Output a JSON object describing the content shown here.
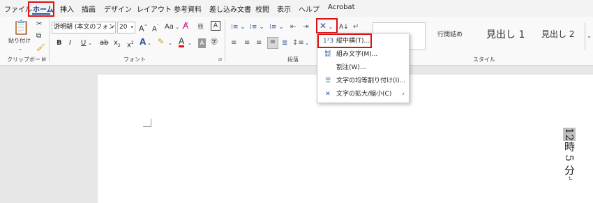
{
  "tabs": [
    "ファイル",
    "ホーム",
    "挿入",
    "描画",
    "デザイン",
    "レイアウト",
    "参考資料",
    "差し込み文書",
    "校閲",
    "表示",
    "ヘルプ",
    "Acrobat"
  ],
  "clipboard": {
    "paste_label": "貼り付け",
    "group_label": "クリップボード"
  },
  "font": {
    "name": "游明朝 (本文のフォント",
    "size": "20",
    "grow": "A",
    "shrink": "A",
    "case": "Aa",
    "bold": "B",
    "italic": "I",
    "underline": "U",
    "strike": "ab",
    "subscript": "x",
    "superscript": "x",
    "group_label": "フォント"
  },
  "paragraph": {
    "group_label": "段落"
  },
  "styles": {
    "items": [
      "行間詰め",
      "見出し 1",
      "見出し 2"
    ],
    "group_label": "スタイル"
  },
  "menu": {
    "items": [
      {
        "label": "縦中横(T)...",
        "icon": "tate-chu-yoko-icon"
      },
      {
        "label": "組み文字(M)...",
        "icon": "kumimoji-icon"
      },
      {
        "label": "割注(W)...",
        "icon": "warichu-icon"
      },
      {
        "label": "文字の均等割り付け(I)...",
        "icon": "distribute-icon"
      },
      {
        "label": "文字の拡大/縮小(C)",
        "icon": "char-scale-icon"
      }
    ]
  },
  "document": {
    "text_number": "12",
    "text_rest": "時 5 分",
    "para_mark": "↵"
  },
  "colors": {
    "accent": "#2b579a",
    "highlight": "#e01010",
    "page": "#ffffff",
    "workspace": "#e7e7e7"
  }
}
